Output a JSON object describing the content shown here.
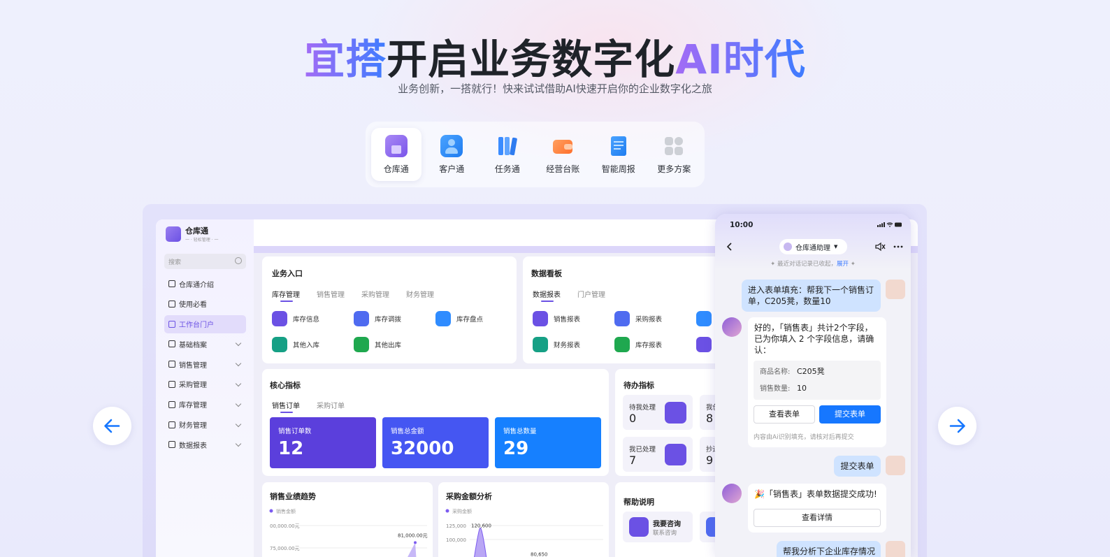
{
  "hero": {
    "title_pre": "宜搭",
    "title_mid": "开启业务数字化",
    "title_post": "AI时代",
    "subtitle": "业务创新，一搭就行！快来试试借助AI快速开启你的企业数字化之旅"
  },
  "categories": [
    {
      "label": "仓库通",
      "icon": "warehouse-icon",
      "color": "#8b67f0"
    },
    {
      "label": "客户通",
      "icon": "customer-icon",
      "color": "#2f8cff"
    },
    {
      "label": "任务通",
      "icon": "task-icon",
      "color": "#2f8cff"
    },
    {
      "label": "经营台账",
      "icon": "wallet-icon",
      "color": "#ff7a2f"
    },
    {
      "label": "智能周报",
      "icon": "report-icon",
      "color": "#2f8cff"
    },
    {
      "label": "更多方案",
      "icon": "more-icon",
      "color": "#c9cbd2"
    }
  ],
  "app": {
    "brand": {
      "name": "仓库通",
      "sub": "一 · 轻松管理 · 一"
    },
    "search_placeholder": "搜索",
    "nav": [
      {
        "label": "仓库通介绍",
        "icon": "home-icon",
        "expandable": false
      },
      {
        "label": "使用必看",
        "icon": "doc-icon",
        "expandable": false
      },
      {
        "label": "工作台门户",
        "icon": "grid-icon",
        "expandable": false
      },
      {
        "label": "基础档案",
        "icon": "cube-icon",
        "expandable": true
      },
      {
        "label": "销售管理",
        "icon": "user-icon",
        "expandable": true
      },
      {
        "label": "采购管理",
        "icon": "bag-icon",
        "expandable": true
      },
      {
        "label": "库存管理",
        "icon": "store-icon",
        "expandable": true
      },
      {
        "label": "财务管理",
        "icon": "coin-icon",
        "expandable": true
      },
      {
        "label": "数据报表",
        "icon": "pie-icon",
        "expandable": true
      }
    ],
    "business_entry": {
      "title": "业务入口",
      "tabs": [
        "库存管理",
        "销售管理",
        "采购管理",
        "财务管理"
      ],
      "items": [
        {
          "label": "库存信息",
          "color": "#6b51e4"
        },
        {
          "label": "库存调拨",
          "color": "#4f6bf0"
        },
        {
          "label": "库存盘点",
          "color": "#2f8cff"
        },
        {
          "label": "其他入库",
          "color": "#16a085"
        },
        {
          "label": "其他出库",
          "color": "#1fa84f"
        }
      ]
    },
    "data_board": {
      "title": "数据看板",
      "tabs": [
        "数据报表",
        "门户管理"
      ],
      "items": [
        {
          "label": "销售报表",
          "color": "#6b51e4"
        },
        {
          "label": "采购报表",
          "color": "#4f6bf0"
        },
        {
          "label": "",
          "color": "#2f8cff"
        },
        {
          "label": "财务报表",
          "color": "#16a085"
        },
        {
          "label": "库存报表",
          "color": "#1fa84f"
        },
        {
          "label": "",
          "color": "#6b51e4"
        }
      ]
    },
    "core": {
      "title": "核心指标",
      "tabs": [
        "销售订单",
        "采购订单"
      ],
      "kpis": [
        {
          "label": "销售订单数",
          "value": "12",
          "color": "#5b3fdc"
        },
        {
          "label": "销售总金额",
          "value": "32000",
          "color": "#4556f2"
        },
        {
          "label": "销售总数量",
          "value": "29",
          "color": "#1680ff"
        }
      ]
    },
    "todo": {
      "title": "待办指标",
      "items": [
        {
          "label": "待我处理",
          "value": "0"
        },
        {
          "label": "我创",
          "value": "8"
        },
        {
          "label": "我已处理",
          "value": "7"
        },
        {
          "label": "抄送",
          "value": "9"
        }
      ]
    },
    "sales_trend": {
      "title": "销售业绩趋势"
    },
    "purchase_analysis": {
      "title": "采购金额分析"
    },
    "help": {
      "title": "帮助说明",
      "item_title": "我要咨询",
      "item_sub": "联系咨询"
    }
  },
  "chart_data": [
    {
      "type": "area",
      "title": "销售业绩趋势",
      "series": [
        {
          "name": "销售金额",
          "values": [
            81000
          ]
        }
      ],
      "yticks": [
        "00,000.00元",
        "75,000.00元"
      ],
      "labels": [
        "81,000.00元"
      ]
    },
    {
      "type": "area",
      "title": "采购金额分析",
      "series": [
        {
          "name": "采购金额",
          "values": [
            120600,
            80650
          ]
        }
      ],
      "yticks": [
        "125,000",
        "100,000"
      ],
      "labels": [
        "120,600",
        "80,650"
      ]
    }
  ],
  "phone": {
    "time": "10:00",
    "title": "仓库通助理",
    "hint_text": "最近对话记录已收起，",
    "hint_link": "展开",
    "messages": {
      "user1": "进入表单填充：帮我下一个销售订单，C205凳，数量10",
      "bot1": "好的，「销售表」共计2个字段，已为你填入 2 个字段信息，请确认：",
      "field1_label": "商品名称:",
      "field1_value": "C205凳",
      "field2_label": "销售数量:",
      "field2_value": "10",
      "view_form": "查看表单",
      "submit_form": "提交表单",
      "note": "内容由Ai识别填充，请核对后再提交",
      "user2": "提交表单",
      "bot2": "🎉「销售表」表单数据提交成功!",
      "view_detail": "查看详情",
      "user3": "帮我分析下企业库存情况"
    }
  },
  "colors": {
    "accent": "#6b51e4",
    "blue": "#1677ff"
  }
}
